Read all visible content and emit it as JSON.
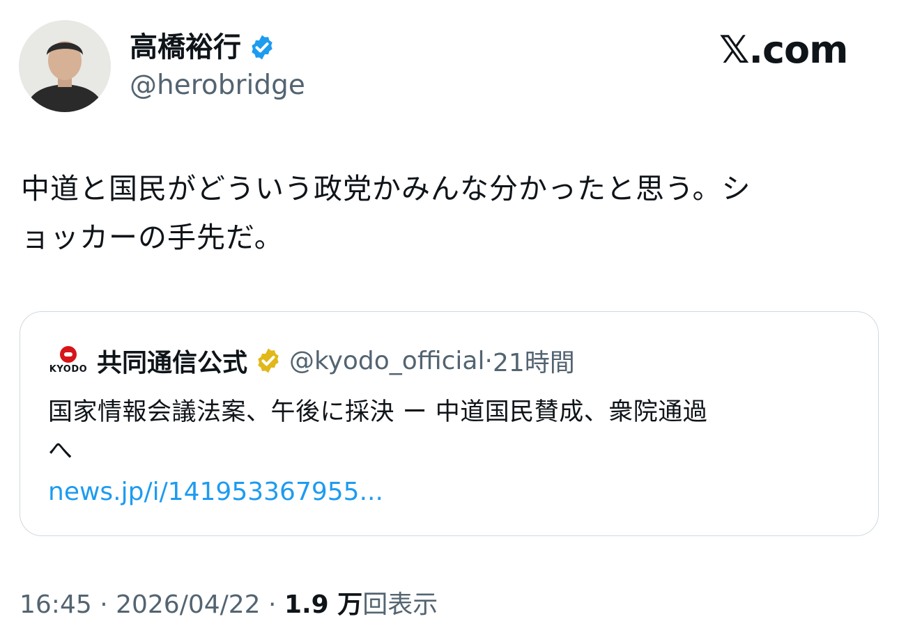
{
  "author": {
    "name": "高橋裕行",
    "handle": "@herobridge",
    "avatar_icon": "person-avatar",
    "verified_color": "#1d9bf0"
  },
  "brand": {
    "logo_text": "𝕏.com"
  },
  "tweet": {
    "text": "中道と国民がどういう政党かみんな分かったと思う。シ\nョッカーの手先だ。"
  },
  "quote": {
    "source_logo_text": "KYODO",
    "source_name": "共同通信公式",
    "source_badge_color": "#e2b719",
    "source_handle": "@kyodo_official",
    "separator": "·",
    "time_ago": "21時間",
    "text": "国家情報会議法案、午後に採決 ー 中道国民賛成、衆院通過\nへ",
    "link": "news.jp/i/141953367955..."
  },
  "footer": {
    "time": "16:45",
    "sep1": " · ",
    "date": "2026/04/22",
    "sep2": " · ",
    "views_count": "1.9 万",
    "views_label": "回表示"
  }
}
